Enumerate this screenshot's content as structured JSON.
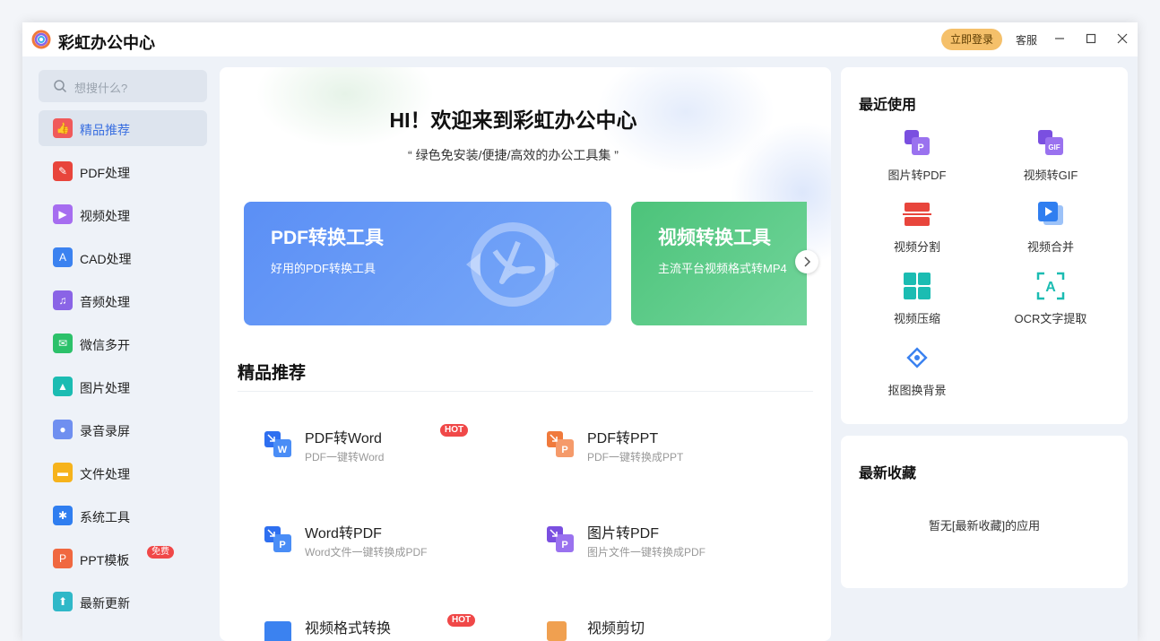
{
  "app": {
    "title": "彩虹办公中心",
    "login_label": "立即登录",
    "service_label": "客服"
  },
  "sidebar": {
    "search_placeholder": "想搜什么?",
    "items": [
      {
        "label": "精品推荐",
        "icon": "thumb-up-icon",
        "color": "#f05a5a",
        "active": true
      },
      {
        "label": "PDF处理",
        "icon": "pdf-icon",
        "color": "#e8453c"
      },
      {
        "label": "视频处理",
        "icon": "play-icon",
        "color": "#a66df0"
      },
      {
        "label": "CAD处理",
        "icon": "cad-icon",
        "color": "#3b82f0"
      },
      {
        "label": "音频处理",
        "icon": "music-icon",
        "color": "#8a64e6"
      },
      {
        "label": "微信多开",
        "icon": "wechat-icon",
        "color": "#2cc16a"
      },
      {
        "label": "图片处理",
        "icon": "image-icon",
        "color": "#1bbcb2"
      },
      {
        "label": "录音录屏",
        "icon": "microphone-icon",
        "color": "#6f8ff0"
      },
      {
        "label": "文件处理",
        "icon": "folder-icon",
        "color": "#f6b31c"
      },
      {
        "label": "系统工具",
        "icon": "gear-icon",
        "color": "#2f7ef0"
      },
      {
        "label": "PPT模板",
        "icon": "ppt-icon",
        "color": "#f06840",
        "badge": "免费"
      },
      {
        "label": "最新更新",
        "icon": "upload-icon",
        "color": "#2fb8c8"
      }
    ]
  },
  "main": {
    "hero_title": "HI！欢迎来到彩虹办公中心",
    "hero_subtitle": "“ 绿色免安装/便捷/高效的办公工具集 ”",
    "banners": [
      {
        "title": "PDF转换工具",
        "subtitle": "好用的PDF转换工具"
      },
      {
        "title": "视频转换工具",
        "subtitle": "主流平台视频格式转MP4"
      }
    ],
    "section_title": "精品推荐",
    "tools": [
      {
        "name": "PDF转Word",
        "desc": "PDF一键转Word",
        "hot": "HOT"
      },
      {
        "name": "PDF转PPT",
        "desc": "PDF一键转换成PPT"
      },
      {
        "name": "Word转PDF",
        "desc": "Word文件一键转换成PDF"
      },
      {
        "name": "图片转PDF",
        "desc": "图片文件一键转换成PDF"
      },
      {
        "name": "视频格式转换",
        "hot": "HOT"
      },
      {
        "name": "视频剪切"
      }
    ]
  },
  "recent": {
    "title": "最近使用",
    "items": [
      {
        "label": "图片转PDF",
        "icon": "image-to-pdf-icon"
      },
      {
        "label": "视频转GIF",
        "icon": "video-to-gif-icon"
      },
      {
        "label": "视频分割",
        "icon": "video-split-icon"
      },
      {
        "label": "视频合并",
        "icon": "video-merge-icon"
      },
      {
        "label": "视频压缩",
        "icon": "video-compress-icon"
      },
      {
        "label": "OCR文字提取",
        "icon": "ocr-icon"
      },
      {
        "label": "抠图换背景",
        "icon": "cutout-icon"
      }
    ]
  },
  "favorites": {
    "title": "最新收藏",
    "empty_message": "暂无[最新收藏]的应用"
  }
}
